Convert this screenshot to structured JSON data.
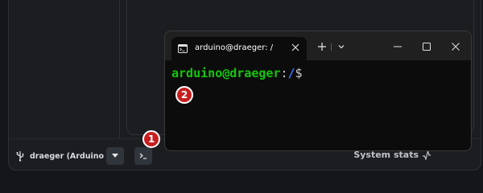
{
  "bottom_bar": {
    "device_label": "draeger (Arduino ...",
    "system_stats_label": "System stats"
  },
  "terminal": {
    "tab_title": "arduino@draeger: /",
    "prompt_user_host": "arduino@draeger",
    "prompt_sep": ":",
    "prompt_path": "/",
    "prompt_symbol": "$"
  },
  "badges": [
    "1",
    "2"
  ],
  "colors": {
    "badge": "#c81e1e",
    "prompt_user": "#16c60c",
    "prompt_path": "#3b78ff",
    "terminal_bg": "#0c0c0c"
  },
  "icons": [
    "usb-icon",
    "chevron-down-icon",
    "terminal-icon",
    "activity-icon",
    "terminal-tab-icon",
    "close-icon",
    "plus-icon",
    "minimize-icon",
    "maximize-icon"
  ]
}
